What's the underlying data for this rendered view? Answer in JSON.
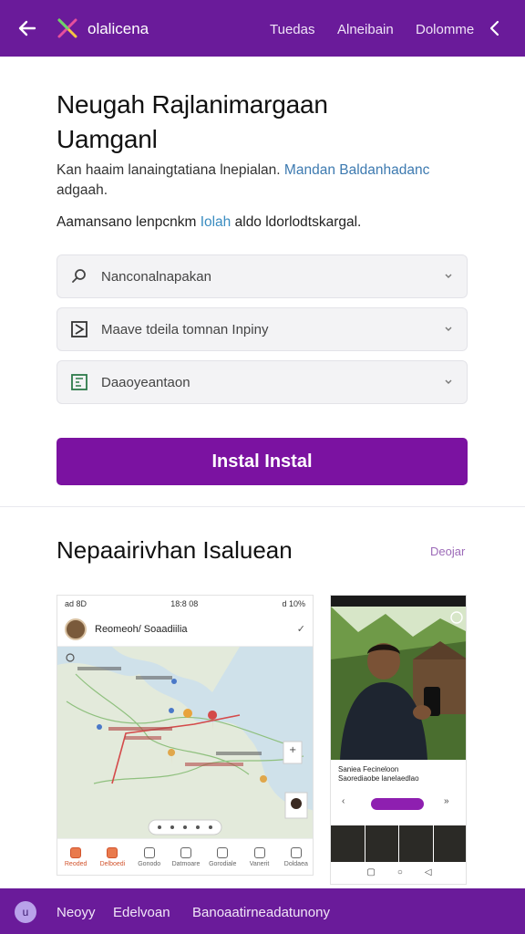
{
  "header": {
    "brand": "olalicena",
    "nav": [
      "Tuedas",
      "Alneibain",
      "Dolomme"
    ]
  },
  "hero": {
    "title_line1": "Neugah Rajlanimargaan",
    "title_line2": "Uamganl",
    "desc_text": "Kan haaim lanaingtatiana lnepialan.",
    "desc_link": "Mandan Baldanhadanc",
    "desc_text2": "adgaah.",
    "note_text1": "Aamansano lenpcnkm",
    "note_link": "Iolah",
    "note_text2": "aldo ldorlodtskargal."
  },
  "fields": [
    {
      "label": "Nanconalnapakan",
      "icon": "search-icon"
    },
    {
      "label": "Maave tdeila tomnan Inpiny",
      "icon": "play-box-icon"
    },
    {
      "label": "Daaoyeantaon",
      "icon": "calendar-icon"
    }
  ],
  "install_button": "Instal Instal",
  "section": {
    "title": "Nepaairivhan Isaluean",
    "link": "Deojar"
  },
  "shot1": {
    "status_left": "ad 8D",
    "status_center": "18:8 08",
    "status_right": "d 10%",
    "header_text": "Reomeoh/ Soaadiilia",
    "tabs": [
      "Reoded",
      "Delboedi",
      "Gonodo",
      "Datmoare",
      "Gorodiale",
      "Vanerit",
      "Doldaea"
    ]
  },
  "shot2": {
    "card_line1": "Saniea Fecineloon",
    "card_line2": "Saorediaobe lanelaedlao"
  },
  "bottom": {
    "badge": "u",
    "items": [
      "Neoyy",
      "Edelvoan",
      "Banoaatirneadatunony"
    ]
  }
}
